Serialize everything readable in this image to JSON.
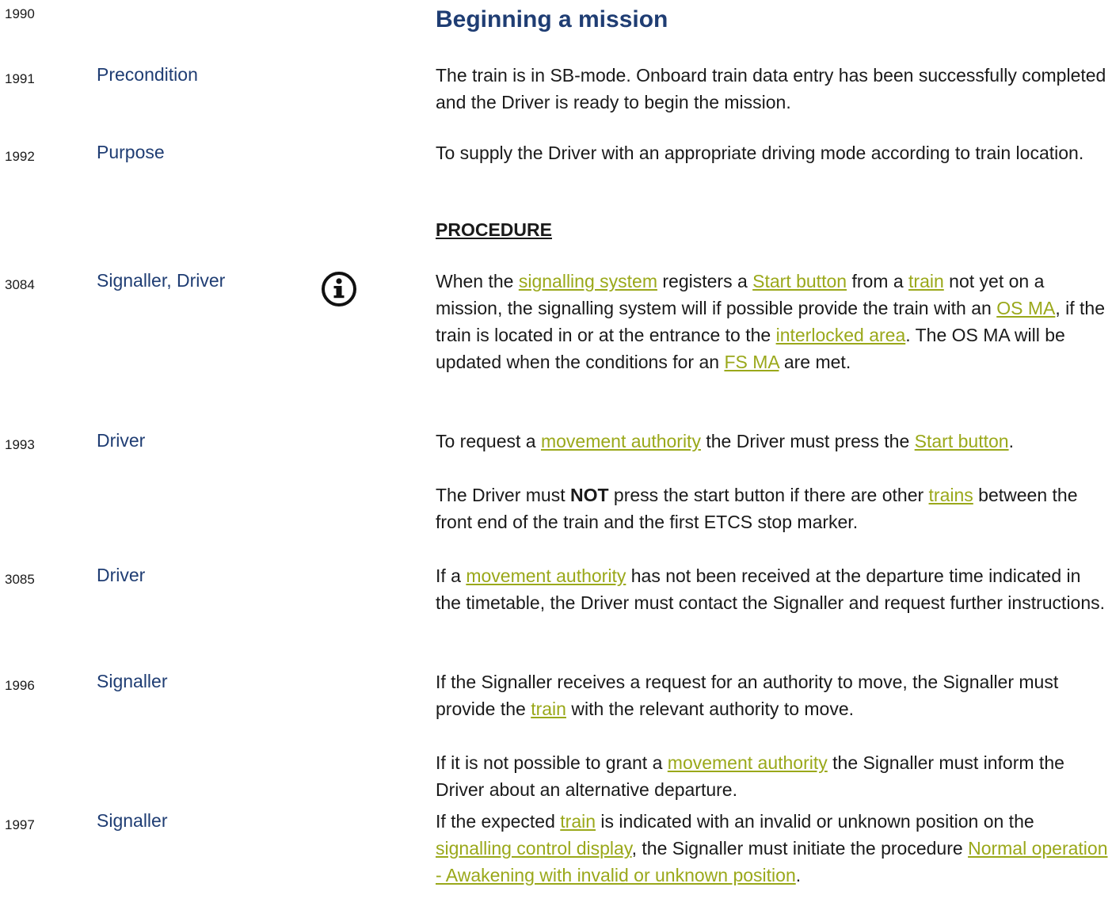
{
  "header": {
    "number": "1990",
    "title": "Beginning a mission"
  },
  "precondition": {
    "number": "1991",
    "role": "Precondition",
    "text": "The train is in SB-mode. Onboard train data entry has been successfully completed and the Driver is ready to begin the mission."
  },
  "purpose": {
    "number": "1992",
    "role": "Purpose",
    "text": "To supply the Driver with an appropriate driving mode according to train location."
  },
  "procedure_heading": "PROCEDURE",
  "r3084": {
    "number": "3084",
    "role": "Signaller, Driver",
    "icon": "info-icon",
    "t1": "When the ",
    "l1": "signalling system",
    "t2": " registers a ",
    "l2": "Start button",
    "t3": " from a ",
    "l3": "train",
    "t4": " not yet on a mission, the signalling system will if possible provide the train with an ",
    "l4": "OS MA",
    "t5": ", if the train is located in or at the entrance to the ",
    "l5": "interlocked area",
    "t6": ". The OS MA will be updated when the conditions for an ",
    "l6": "FS MA",
    "t7": " are met."
  },
  "r1993": {
    "number": "1993",
    "role": "Driver",
    "t1": "To request a ",
    "l1": "movement authority",
    "t2": " the Driver must press the ",
    "l2": "Start button",
    "t3": ".",
    "p2_t1": "The Driver must ",
    "p2_b": "NOT",
    "p2_t2": " press the start button if there are other ",
    "p2_l1": "trains",
    "p2_t3": " between the front end of the train and the first ETCS stop marker."
  },
  "r3085": {
    "number": "3085",
    "role": "Driver",
    "t1": "If a ",
    "l1": "movement authority",
    "t2": " has not been received at the departure time indicated in the timetable, the Driver must contact the Signaller and request further instructions."
  },
  "r1996": {
    "number": "1996",
    "role": "Signaller",
    "t1": "If the Signaller receives a request for an authority to move, the Signaller must provide the ",
    "l1": "train",
    "t2": " with the relevant authority to move.",
    "p2_t1": "If it is not possible to grant a ",
    "p2_l1": "movement authority",
    "p2_t2": " the Signaller must inform the Driver about an alternative departure."
  },
  "r1997": {
    "number": "1997",
    "role": "Signaller",
    "t1": "If the expected ",
    "l1": "train",
    "t2": " is indicated with an invalid or unknown position on the ",
    "l2": "signalling control display",
    "t3": ", the Signaller must initiate the procedure ",
    "l3": "Normal operation - Awakening with invalid or unknown position",
    "t4": "."
  }
}
